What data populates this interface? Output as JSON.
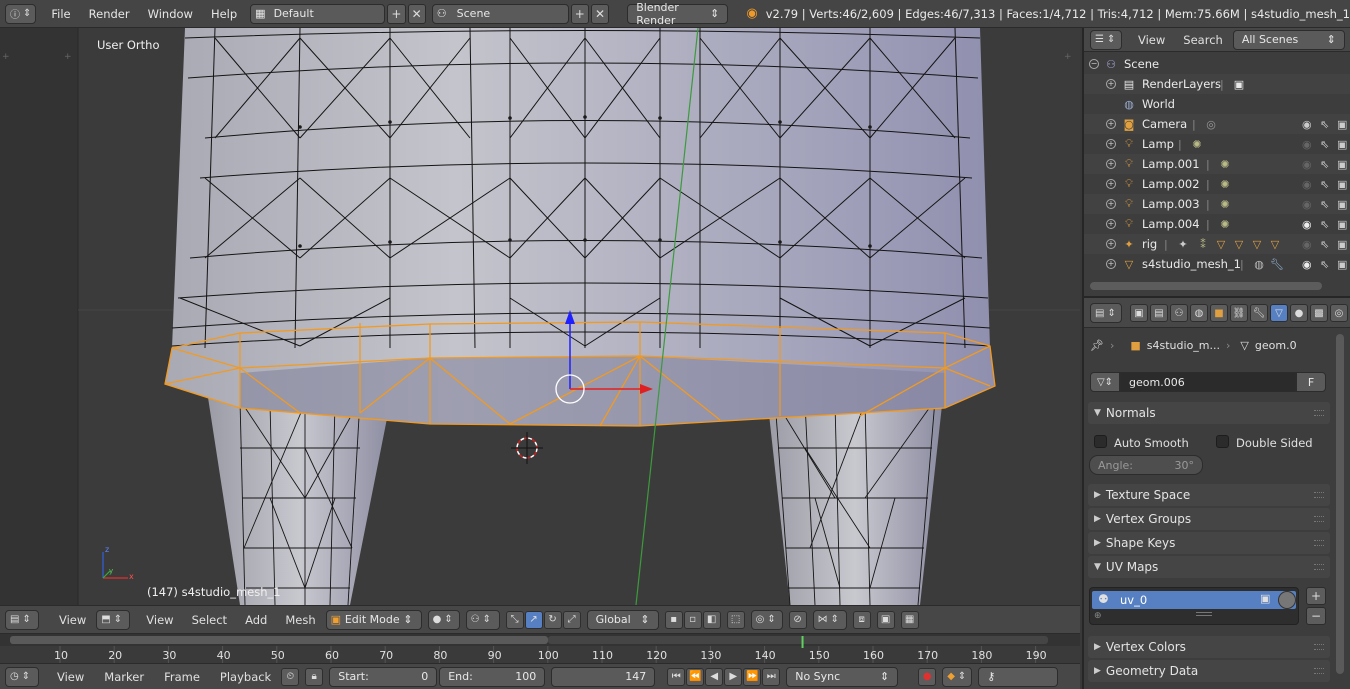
{
  "topbar": {
    "menus": [
      "File",
      "Render",
      "Window",
      "Help"
    ],
    "layout": "Default",
    "scene": "Scene",
    "engine": "Blender Render",
    "stats": "v2.79 | Verts:46/2,609 | Edges:46/7,313 | Faces:1/4,712 | Tris:4,712 | Mem:75.66M | s4studio_mesh_1"
  },
  "viewport": {
    "view_name": "User Ortho",
    "object_info": "(147) s4studio_mesh_1"
  },
  "view3d_header": {
    "menus": [
      "View",
      "Select",
      "Add",
      "Mesh"
    ],
    "mode": "Edit Mode",
    "orientation": "Global"
  },
  "timeline": {
    "ticks": [
      "10",
      "20",
      "30",
      "40",
      "50",
      "60",
      "70",
      "80",
      "90",
      "100",
      "110",
      "120",
      "130",
      "140",
      "150",
      "160",
      "170",
      "180",
      "190"
    ],
    "current_frame_marker": 147
  },
  "timeline_header": {
    "menus": [
      "View",
      "Marker",
      "Frame",
      "Playback"
    ],
    "start_label": "Start:",
    "start_value": "0",
    "end_label": "End:",
    "end_value": "100",
    "current_frame": "147",
    "sync": "No Sync"
  },
  "outliner": {
    "menus": [
      "View",
      "Search"
    ],
    "filter": "All Scenes",
    "items": [
      {
        "label": "Scene",
        "icon": "scene-icon"
      },
      {
        "label": "RenderLayers",
        "icon": "renderlayers-icon"
      },
      {
        "label": "World",
        "icon": "world-icon"
      },
      {
        "label": "Camera",
        "icon": "camera-icon"
      },
      {
        "label": "Lamp",
        "icon": "lamp-icon"
      },
      {
        "label": "Lamp.001",
        "icon": "lamp-icon"
      },
      {
        "label": "Lamp.002",
        "icon": "lamp-icon"
      },
      {
        "label": "Lamp.003",
        "icon": "lamp-icon"
      },
      {
        "label": "Lamp.004",
        "icon": "lamp-icon"
      },
      {
        "label": "rig",
        "icon": "armature-icon"
      },
      {
        "label": "s4studio_mesh_1",
        "icon": "mesh-icon"
      }
    ]
  },
  "properties": {
    "breadcrumb_object": "s4studio_m...",
    "breadcrumb_data": "geom.0",
    "datablock_name": "geom.006",
    "fake_user": "F",
    "panels": {
      "normals": "Normals",
      "auto_smooth": "Auto Smooth",
      "double_sided": "Double Sided",
      "angle_label": "Angle:",
      "angle_value": "30°",
      "texture_space": "Texture Space",
      "vertex_groups": "Vertex Groups",
      "shape_keys": "Shape Keys",
      "uv_maps": "UV Maps",
      "uv_map_item": "uv_0",
      "vertex_colors": "Vertex Colors",
      "geometry_data": "Geometry Data"
    }
  },
  "colors": {
    "selection": "#f39a1e",
    "active_blue": "#5680c2",
    "panel": "#3d3d3d",
    "header": "#474747",
    "mesh_fill": "#b7b7c3"
  }
}
